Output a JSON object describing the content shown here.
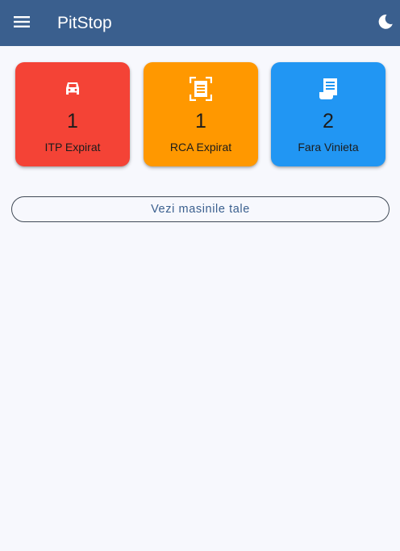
{
  "appbar": {
    "title": "PitStop",
    "menu_icon": "menu-icon",
    "theme_icon": "moon-icon",
    "background": "#3a5f8e"
  },
  "cards": [
    {
      "icon": "car-icon",
      "count": "1",
      "label": "ITP Expirat",
      "color": "#f44336"
    },
    {
      "icon": "document-scan-icon",
      "count": "1",
      "label": "RCA Expirat",
      "color": "#ff9800"
    },
    {
      "icon": "receipt-icon",
      "count": "2",
      "label": "Fara Vinieta",
      "color": "#2196f3"
    }
  ],
  "actions": {
    "view_cars_label": "Vezi masinile tale"
  }
}
